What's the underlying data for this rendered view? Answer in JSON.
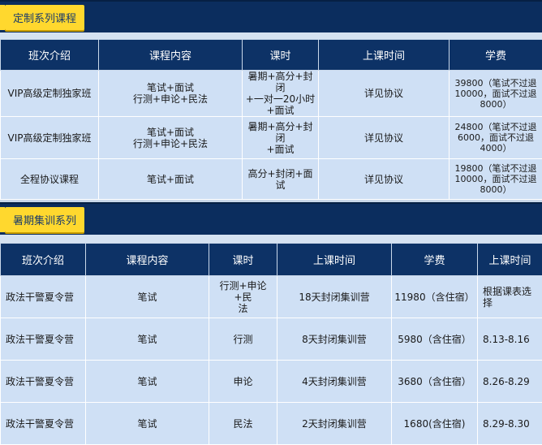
{
  "section1": {
    "title": "定制系列课程",
    "headers": [
      "班次介绍",
      "课程内容",
      "课时",
      "上课时间",
      "学费"
    ],
    "rows": [
      [
        "VIP高级定制独家班",
        "笔试+面试\n行测+申论+民法",
        "暑期+高分+封闭\n+一对一20小时\n+面试",
        "详见协议",
        "39800（笔试不过退\n10000，面试不过退\n8000）"
      ],
      [
        "VIP高级定制独家班",
        "笔试+面试\n行测+申论+民法",
        "暑期+高分+封闭\n+面试",
        "详见协议",
        "24800（笔试不过退\n6000，面试不过退\n4000）"
      ],
      [
        "全程协议课程",
        "笔试+面试",
        "高分+封闭+面试",
        "详见协议",
        "19800（笔试不过退\n10000，面试不过退\n8000）"
      ]
    ]
  },
  "section2": {
    "title": "暑期集训系列",
    "headers": [
      "班次介绍",
      "课程内容",
      "课时",
      "上课时间",
      "学费",
      "上课时间"
    ],
    "rows": [
      [
        "政法干警夏令营",
        "笔试",
        "行测+申论+民\n法",
        "18天封闭集训营",
        "11980（含住宿）",
        "根据课表选择"
      ],
      [
        "政法干警夏令营",
        "笔试",
        "行测",
        "8天封闭集训营",
        "5980（含住宿）",
        "8.13-8.16"
      ],
      [
        "政法干警夏令营",
        "笔试",
        "申论",
        "4天封闭集训营",
        "3680（含住宿）",
        "8.26-8.29"
      ],
      [
        "政法干警夏令营",
        "笔试",
        "民法",
        "2天封闭集训营",
        "1680(含住宿)",
        "8.29-8.30"
      ]
    ]
  },
  "colors": {
    "header_bg": "#0d3266",
    "tab_bg": "#ffd82e",
    "cell_bg": "#cfe0f5"
  }
}
